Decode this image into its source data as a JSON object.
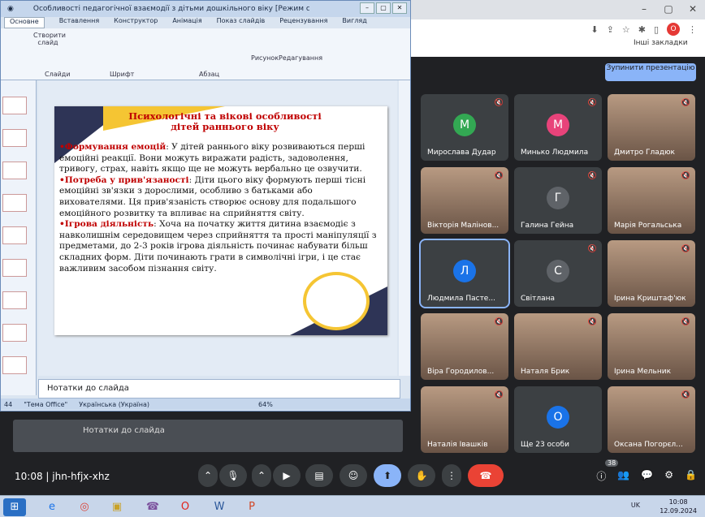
{
  "browser": {
    "controls": [
      "–",
      "▢",
      "✕"
    ],
    "profile_initial": "О",
    "bookmarks": "Інші закладки"
  },
  "meet": {
    "stop_presenting": "Зупинити презентацію",
    "participants": [
      {
        "name": "Мирослава Дудар",
        "initial": "М",
        "color": "#33a853",
        "muted": true
      },
      {
        "name": "Минько Людмила",
        "initial": "М",
        "color": "#e8437a",
        "muted": true
      },
      {
        "name": "Дмитро Гладюк",
        "initial": "",
        "photo": true,
        "muted": true
      },
      {
        "name": "Вікторія Малінов...",
        "initial": "",
        "photo": true,
        "muted": true
      },
      {
        "name": "Галина Гейна",
        "initial": "Г",
        "color": "#5f6368",
        "muted": true
      },
      {
        "name": "Марія Рогальська",
        "initial": "",
        "photo": true,
        "muted": true
      },
      {
        "name": "Людмила Пасте...",
        "initial": "Л",
        "color": "#1a73e8",
        "muted": false,
        "active": true
      },
      {
        "name": "Світлана",
        "initial": "С",
        "color": "#5f6368",
        "muted": true,
        "hand": true
      },
      {
        "name": "Ірина Криштаф'юк",
        "initial": "",
        "photo": true,
        "muted": true
      },
      {
        "name": "Віра Городилов...",
        "initial": "",
        "photo": true,
        "muted": true
      },
      {
        "name": "Наталя Брик",
        "initial": "",
        "photo": true,
        "muted": true
      },
      {
        "name": "Ірина Мельник",
        "initial": "",
        "photo": true,
        "muted": true
      },
      {
        "name": "Наталія Івашків",
        "initial": "",
        "photo": true,
        "muted": true
      },
      {
        "name": "Ще 23 особи",
        "initial": "О",
        "color": "#1a73e8",
        "more": true
      },
      {
        "name": "Оксана Погорєл...",
        "initial": "",
        "photo": true,
        "muted": true
      }
    ],
    "time": "10:08",
    "code": "jhn-hfjx-xhz",
    "participants_count": "38",
    "ghost_notes": "Нотатки до слайда"
  },
  "ppt": {
    "title": "Особливості педагогічної взаємодії з дітьми дошкільного віку [Режим сумісності] - М...",
    "tabs": [
      "Основне",
      "Вставлення",
      "Конструктор",
      "Анімація",
      "Показ слайдів",
      "Рецензування",
      "Вигляд"
    ],
    "groups": {
      "slides": "Слайди",
      "font": "Шрифт",
      "paragraph": "Абзац",
      "drawing": "Рисунок",
      "editing": "Редагування",
      "create": "Створити слайд"
    },
    "slide": {
      "title1": "Психологічні та вікові особливості",
      "title2": "дітей раннього віку",
      "p1_head": "•Формування емоцій",
      "p1": ": У дітей раннього віку розвиваються перші емоційні реакції. Вони можуть виражати радість, задоволення, тривогу, страх, навіть якщо ще не можуть вербально це озвучити.",
      "p2_head": "•Потреба у прив'язаності",
      "p2": ": Діти цього віку формують перші тісні емоційні зв'язки з дорослими, особливо з батьками або вихователями. Ця прив'язаність створює основу для подальшого емоційного розвитку та впливає на сприйняття світу.",
      "p3_head": "•Ігрова діяльність",
      "p3": ": Хоча на початку життя дитина взаємодіє з навколишнім середовищем через сприйняття та прості маніпуляції з предметами, до 2-3 років ігрова діяльність починає набувати більш складних форм. Діти починають грати в символічні ігри, і це стає важливим засобом пізнання світу."
    },
    "notes": "Нотатки до слайда",
    "status": {
      "slide": "44",
      "theme": "\"Тема Office\"",
      "lang": "Українська (Україна)",
      "zoom": "64%"
    }
  },
  "taskbar": {
    "lang": "UK",
    "time": "10:08",
    "date": "12.09.2024"
  }
}
